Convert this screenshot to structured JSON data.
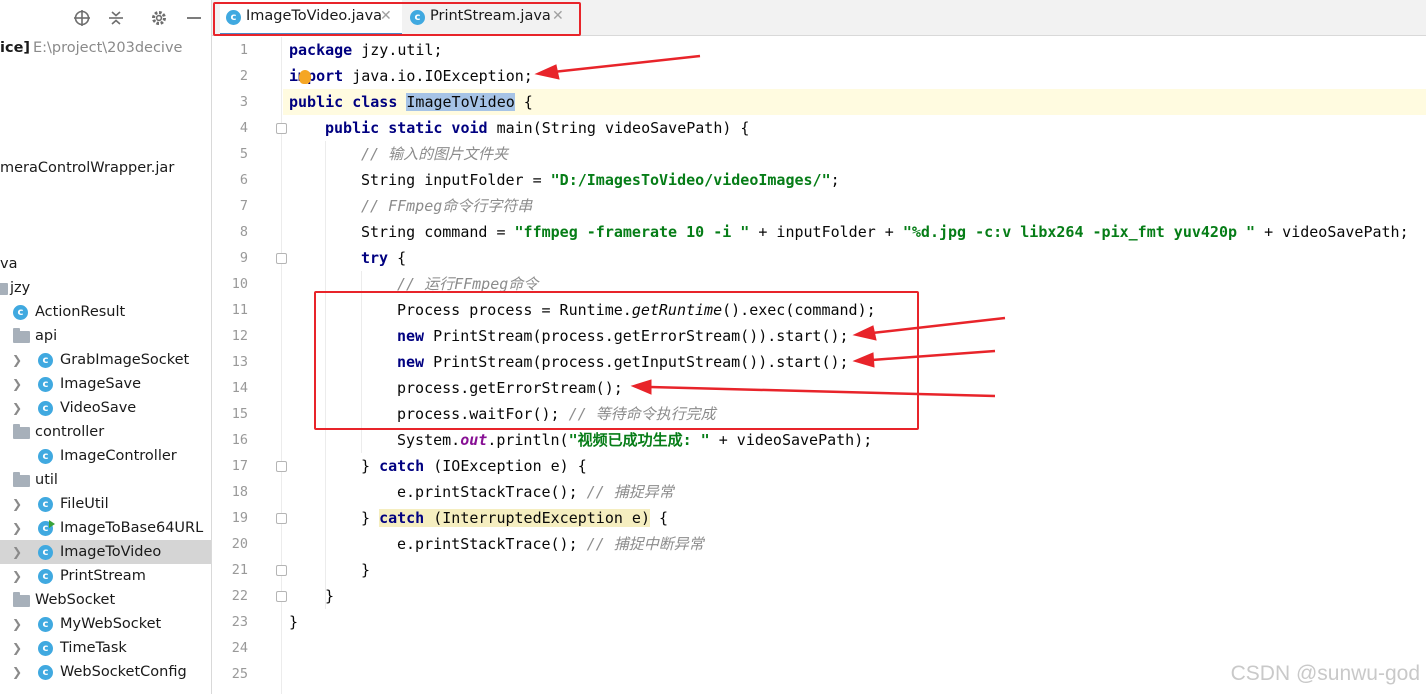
{
  "sidebar": {
    "project_name": "ice]",
    "project_path": "E:\\project\\203decive",
    "items": [
      {
        "label": "meraControlWrapper.jar",
        "kind": "text"
      },
      {
        "label": "va",
        "kind": "text"
      },
      {
        "label": "jzy",
        "kind": "package"
      },
      {
        "label": "ActionResult",
        "kind": "class"
      },
      {
        "label": "api",
        "kind": "package"
      },
      {
        "label": "GrabImageSocket",
        "kind": "class"
      },
      {
        "label": "ImageSave",
        "kind": "class"
      },
      {
        "label": "VideoSave",
        "kind": "class"
      },
      {
        "label": "controller",
        "kind": "package"
      },
      {
        "label": "ImageController",
        "kind": "class"
      },
      {
        "label": "util",
        "kind": "package"
      },
      {
        "label": "FileUtil",
        "kind": "class"
      },
      {
        "label": "ImageToBase64URL",
        "kind": "class-runnable"
      },
      {
        "label": "ImageToVideo",
        "kind": "class",
        "selected": true
      },
      {
        "label": "PrintStream",
        "kind": "class"
      },
      {
        "label": "WebSocket",
        "kind": "package"
      },
      {
        "label": "MyWebSocket",
        "kind": "class"
      },
      {
        "label": "TimeTask",
        "kind": "class"
      },
      {
        "label": "WebSocketConfig",
        "kind": "class"
      }
    ]
  },
  "tabs": [
    {
      "label": "ImageToVideo.java",
      "active": true
    },
    {
      "label": "PrintStream.java",
      "active": false
    }
  ],
  "editor": {
    "line_numbers": [
      "1",
      "2",
      "3",
      "4",
      "5",
      "6",
      "7",
      "8",
      "9",
      "10",
      "11",
      "12",
      "13",
      "14",
      "15",
      "16",
      "17",
      "18",
      "19",
      "20",
      "21",
      "22",
      "23",
      "24",
      "25"
    ],
    "lines": {
      "l1_kw": "package",
      "l1_rest": " jzy.util;",
      "l2_kw": "import",
      "l2_rest": " java.io.IOException;",
      "l3_kw": "public class",
      "l3_name": "ImageToVideo",
      "l3_rest": " {",
      "l4_kw": "public static void",
      "l4_rest": " main(String videoSavePath) {",
      "l5_cm": "// 输入的图片文件夹",
      "l6_a": "String inputFolder = ",
      "l6_str": "\"D:/ImagesToVideo/videoImages/\"",
      "l6_b": ";",
      "l7_cm": "// FFmpeg命令行字符串",
      "l8_a": "String command = ",
      "l8_s1": "\"ffmpeg -framerate 10 -i \"",
      "l8_b": " + inputFolder + ",
      "l8_s2": "\"%d.jpg -c:v libx264 -pix_fmt yuv420p \"",
      "l8_c": " + videoSavePath;",
      "l9_kw": "try",
      "l9_rest": " {",
      "l10_cm": "// 运行FFmpeg命令",
      "l11_a": "Process process = Runtime.",
      "l11_it": "getRuntime",
      "l11_b": "().exec(command);",
      "l12_kw": "new",
      "l12_rest": " PrintStream(process.getErrorStream()).start();",
      "l13_kw": "new",
      "l13_rest": " PrintStream(process.getInputStream()).start();",
      "l14": "process.getErrorStream();",
      "l15_a": "process.waitFor(); ",
      "l15_cm": "// 等待命令执行完成",
      "l16_a": "System.",
      "l16_sf": "out",
      "l16_b": ".println(",
      "l16_str": "\"视频已成功生成: \"",
      "l16_c": " + videoSavePath);",
      "l17_a": "} ",
      "l17_kw": "catch",
      "l17_b": " (IOException e) {",
      "l18_a": "e.printStackTrace(); ",
      "l18_cm": "// 捕捉异常",
      "l19_a": "} ",
      "l19_kw": "catch",
      "l19_b": " (InterruptedException e)",
      "l19_c": " {",
      "l20_a": "e.printStackTrace(); ",
      "l20_cm": "// 捕捉中断异常",
      "l21": "}",
      "l22": "}",
      "l23": "}"
    }
  },
  "watermark": "CSDN @sunwu-god",
  "colors": {
    "annotation_red": "#e8242a",
    "keyword": "#000080",
    "string": "#067d17",
    "comment": "#8c8c8c",
    "class_icon": "#40a9e0"
  }
}
